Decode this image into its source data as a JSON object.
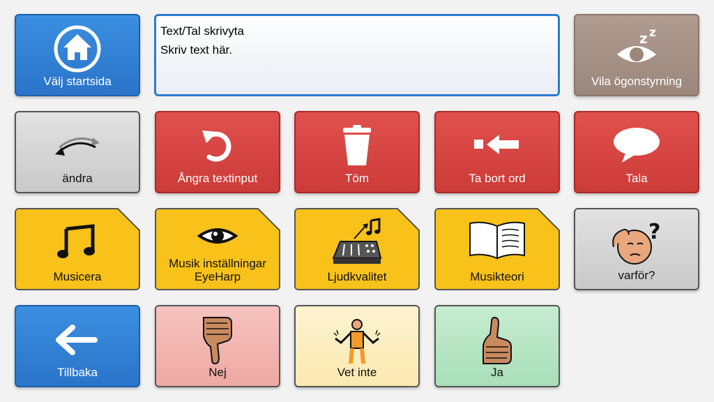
{
  "text_area": {
    "line1": "Text/Tal skrivyta",
    "line2": "Skriv text här."
  },
  "buttons": {
    "home": "Välj startsida",
    "rest": "Vila ögonstyrning",
    "change": "ändra",
    "undo": "Ångra textinput",
    "clear": "Töm",
    "delete_word": "Ta bort ord",
    "speak": "Tala",
    "make_music": "Musicera",
    "music_settings": "Musik inställningar EyeHarp",
    "sound_quality": "Ljudkvalitet",
    "music_theory": "Musikteori",
    "why": "varför?",
    "back": "Tillbaka",
    "no": "Nej",
    "dont_know": "Vet inte",
    "yes": "Ja"
  },
  "colors": {
    "blue": "#2a74c9",
    "red": "#cc3b38",
    "yellow": "#f8c21a",
    "brown": "#9c877c",
    "gray": "#cfcfcf"
  }
}
